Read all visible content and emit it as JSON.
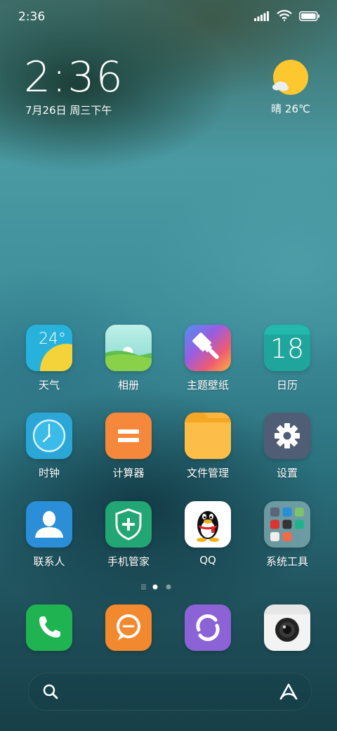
{
  "status_bar": {
    "time": "2:36",
    "icons": [
      "signal-icon",
      "wifi-icon",
      "battery-icon"
    ]
  },
  "clock_widget": {
    "time": "2:36",
    "date": "7月26日 周三下午"
  },
  "weather_widget": {
    "condition": "晴",
    "temperature": "26℃",
    "display": "晴 26℃",
    "icon": "sun-cloud-icon"
  },
  "apps": [
    {
      "label": "天气",
      "icon": "weather-icon",
      "icon_text": "24°"
    },
    {
      "label": "相册",
      "icon": "gallery-icon"
    },
    {
      "label": "主题壁纸",
      "icon": "themes-brush-icon"
    },
    {
      "label": "日历",
      "icon": "calendar-icon",
      "icon_text": "18"
    },
    {
      "label": "时钟",
      "icon": "clock-icon"
    },
    {
      "label": "计算器",
      "icon": "calculator-icon"
    },
    {
      "label": "文件管理",
      "icon": "folder-icon"
    },
    {
      "label": "设置",
      "icon": "gear-icon"
    },
    {
      "label": "联系人",
      "icon": "contacts-icon"
    },
    {
      "label": "手机管家",
      "icon": "shield-plus-icon"
    },
    {
      "label": "QQ",
      "icon": "qq-penguin-icon"
    },
    {
      "label": "系统工具",
      "icon": "folder-grid-icon"
    }
  ],
  "page_indicator": {
    "pages": 2,
    "current": 1
  },
  "dock": [
    {
      "icon": "phone-icon",
      "name": "phone"
    },
    {
      "icon": "messages-icon",
      "name": "messages"
    },
    {
      "icon": "browser-icon",
      "name": "browser"
    },
    {
      "icon": "camera-icon",
      "name": "camera"
    }
  ],
  "search_bar": {
    "left_icon": "search-icon",
    "right_icon": "assistant-icon"
  },
  "colors": {
    "weather_bg": "#27b2dc",
    "gallery_bg": "#6cc86a",
    "calendar_bg": "#1fa59b",
    "clock_bg": "#2aa7d6",
    "calculator_bg": "#f5883a",
    "folder_bg": "#fbb43c",
    "settings_bg": "#4f5d75",
    "contacts_bg": "#2a8fd8",
    "manager_bg": "#22a673",
    "phone_bg": "#1fb352",
    "messages_bg": "#f2892f",
    "browser_bg": "#8c63d6",
    "camera_bg": "#f3f3f3"
  }
}
